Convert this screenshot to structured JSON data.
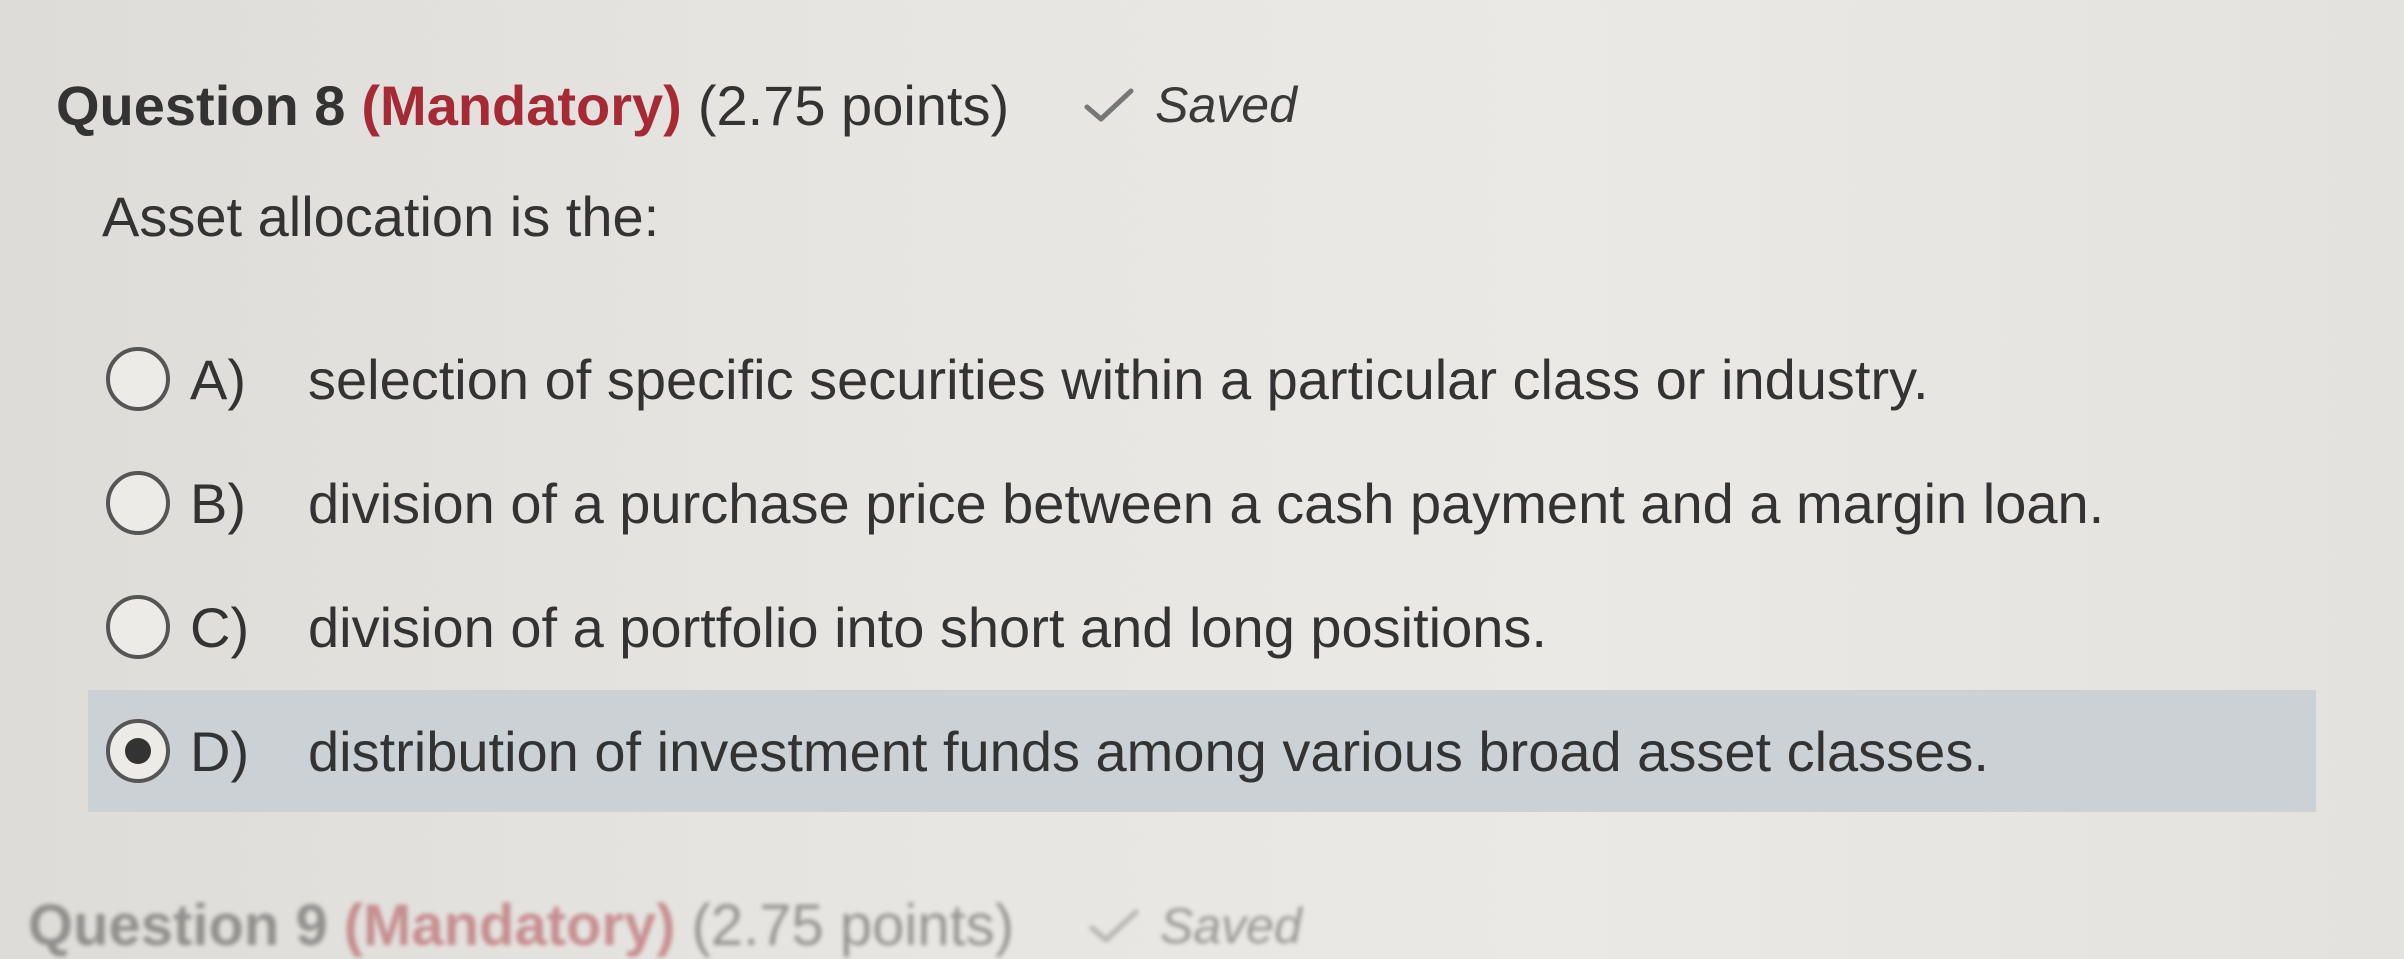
{
  "question": {
    "title": "Question 8",
    "mandatory": "(Mandatory)",
    "points": "(2.75 points)",
    "status": "Saved",
    "status_icon": "checkmark-icon",
    "prompt": "Asset allocation is the:"
  },
  "options": [
    {
      "letter": "A)",
      "text": "selection of specific securities within a particular class or industry.",
      "selected": false
    },
    {
      "letter": "B)",
      "text": "division of a purchase price between a cash payment and a margin loan.",
      "selected": false
    },
    {
      "letter": "C)",
      "text": "division of a portfolio into short and long positions.",
      "selected": false
    },
    {
      "letter": "D)",
      "text": "distribution of investment funds among various broad asset classes.",
      "selected": true
    }
  ],
  "next_question": {
    "title": "Question 9",
    "mandatory": "(Mandatory)",
    "points": "(2.75 points)",
    "status": "Saved"
  },
  "colors": {
    "mandatory": "#a52a35",
    "selected_background": "#cbd1d4",
    "text": "#333333"
  }
}
